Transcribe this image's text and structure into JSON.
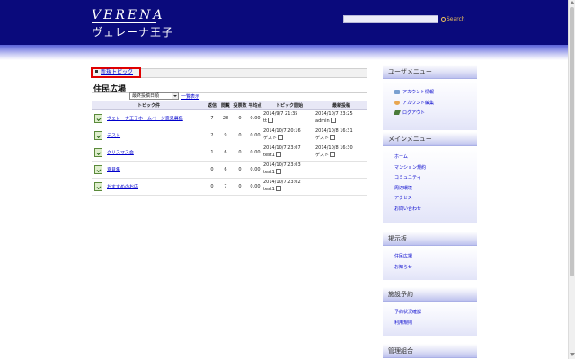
{
  "header": {
    "logo": "VERENA",
    "logo_subtitle": "ヴェレーナ王子",
    "search_label": "Search"
  },
  "breadcrumb": {
    "new_topic_link": "新規トピック"
  },
  "forum": {
    "title": "住民広場",
    "sort_selected": "最終投稿日順",
    "list_link": "一覧表示",
    "columns": [
      "トピック件",
      "返信",
      "閲覧",
      "投票数",
      "平均点",
      "トピック開始",
      "最新投稿"
    ],
    "rows": [
      {
        "title": "ヴェレーナ王子ホームページ意見募集",
        "replies": "7",
        "views": "28",
        "votes": "0",
        "avg": "0.00",
        "start_date": "2014/9/7 21:35",
        "start_user": "tt",
        "last_date": "2014/10/7 23:25",
        "last_user": "admin"
      },
      {
        "title": "テスト",
        "replies": "2",
        "views": "9",
        "votes": "0",
        "avg": "0.00",
        "start_date": "2014/10/7 20:16",
        "start_user": "ゲスト",
        "last_date": "2014/10/8 16:31",
        "last_user": "ゲスト"
      },
      {
        "title": "クリスマス会",
        "replies": "1",
        "views": "6",
        "votes": "0",
        "avg": "0.00",
        "start_date": "2014/10/7 23:07",
        "start_user": "test1",
        "last_date": "2014/10/8 16:30",
        "last_user": "ゲスト"
      },
      {
        "title": "意見集",
        "replies": "0",
        "views": "6",
        "votes": "0",
        "avg": "0.00",
        "start_date": "2014/10/7 23:03",
        "start_user": "test1",
        "last_date": "",
        "last_user": ""
      },
      {
        "title": "おすすめのお店",
        "replies": "0",
        "views": "7",
        "votes": "0",
        "avg": "0.00",
        "start_date": "2014/10/7 23:02",
        "start_user": "test1",
        "last_date": "",
        "last_user": ""
      }
    ]
  },
  "sidebar": {
    "user_menu": {
      "title": "ユーザメニュー",
      "items": [
        "アカウント情報",
        "アカウント編集",
        "ログアウト"
      ]
    },
    "main_menu": {
      "title": "メインメニュー",
      "items": [
        "ホーム",
        "マンション規約",
        "コミュニティ",
        "周辺環境",
        "アクセス",
        "お問い合わせ"
      ]
    },
    "board": {
      "title": "掲示板",
      "items": [
        "住民広場",
        "お知らせ"
      ]
    },
    "facility": {
      "title": "施設予約",
      "items": [
        "予約状況確認",
        "利用規則"
      ]
    },
    "management": {
      "title": "管理組合"
    }
  }
}
